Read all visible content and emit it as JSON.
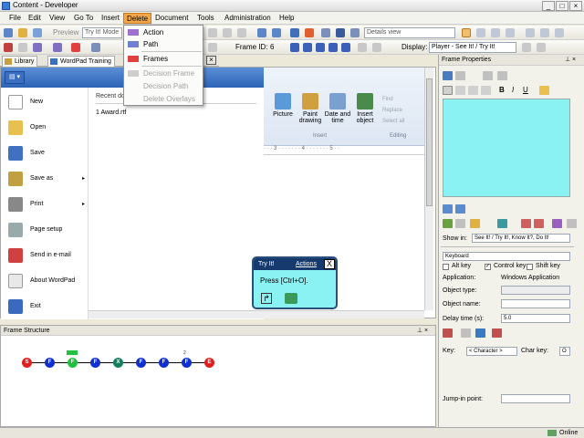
{
  "window": {
    "title": "Content - Developer",
    "minimize": "_",
    "maximize": "□",
    "close": "×"
  },
  "menu": [
    "File",
    "Edit",
    "View",
    "Go To",
    "Insert",
    "Delete",
    "Document",
    "Tools",
    "Administration",
    "Help"
  ],
  "toolbar1": {
    "preview_label": "Preview",
    "mode_value": "Try It! Mode",
    "view_value": "Details view"
  },
  "toolbar2": {
    "frame_label": "Frame ID:",
    "frame_value": "6",
    "display_label": "Display:",
    "display_value": "Player - See It! / Try It!"
  },
  "doc_tabs": [
    "Library",
    "WordPad Training"
  ],
  "delete_menu": {
    "items": [
      {
        "label": "Action",
        "enabled": true
      },
      {
        "label": "Path",
        "enabled": true
      },
      {
        "label": "Frames",
        "enabled": true
      },
      {
        "label": "Decision Frame",
        "enabled": false
      },
      {
        "label": "Decision Path",
        "enabled": false
      },
      {
        "label": "Delete Overlays",
        "enabled": false
      }
    ]
  },
  "wordpad": {
    "menu_items": [
      "New",
      "Open",
      "Save",
      "Save as",
      "Print",
      "Page setup",
      "Send in e-mail",
      "About WordPad",
      "Exit"
    ],
    "recent_header": "Recent documents",
    "recent_item": "1  Award.rtf",
    "ribbon": {
      "buttons": [
        "Picture",
        "Paint drawing",
        "Date and time",
        "Insert object"
      ],
      "insert_group": "Insert",
      "editing_group": "Editing",
      "editing_items": [
        "Find",
        "Replace",
        "Select all"
      ]
    },
    "ruler": "· · · 3 · · · · · · · 4 · · · · · · · 5 · ·"
  },
  "callout": {
    "title": "Try It!",
    "link": "Actions",
    "close": "X",
    "text": "Press [Ctrl+O]."
  },
  "frame_structure": {
    "title": "Frame Structure",
    "nodes": [
      "S",
      "F",
      "F",
      "F",
      "X",
      "F",
      "F",
      "F",
      "E"
    ],
    "tag_label": "2"
  },
  "props": {
    "title": "Frame Properties",
    "show_in_label": "Show in:",
    "show_in_value": "See It! / Try It!, Know It?, Do It!",
    "event_value": "Keyboard",
    "alt_key": "Alt key",
    "control_key": "Control key",
    "shift_key": "Shift key",
    "application_label": "Application:",
    "application_value": "Windows Application",
    "object_type_label": "Object type:",
    "object_name_label": "Object name:",
    "delay_label": "Delay time (s):",
    "delay_value": "5.0",
    "key_label": "Key:",
    "key_value": "< Character >",
    "char_key_label": "Char key:",
    "char_key_value": "O",
    "jump_label": "Jump-in point:"
  },
  "status": {
    "text": "Online"
  },
  "colors": {
    "callout": "#8af2f2",
    "menu_active": "#f3a64a",
    "node_red": "#e02020",
    "node_blue": "#1030d0",
    "node_green": "#20c040",
    "node_teal": "#108060"
  }
}
